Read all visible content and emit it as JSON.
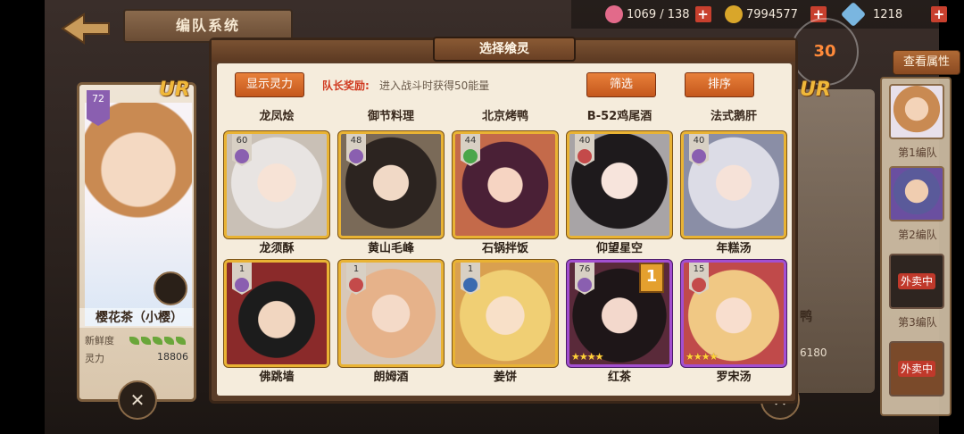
{
  "topbar": {
    "stamina": "1069 / 138",
    "gold": "7994577",
    "gems": "1218"
  },
  "header": {
    "title": "编队系统",
    "view_attributes": "查看属性",
    "counter": "30"
  },
  "leader": {
    "level": "72",
    "rarity": "UR",
    "name": "樱花茶（小樱）",
    "freshness_label": "新鲜度",
    "power_label": "灵力",
    "power_value": "18806"
  },
  "right_slot": {
    "rarity": "UR",
    "name_fragment": "鸭",
    "value_fragment": "6180"
  },
  "side_teams": [
    {
      "label": "第1编队"
    },
    {
      "label": "第2编队"
    },
    {
      "label": "第3编队",
      "status": "外卖中"
    },
    {
      "status": "外卖中"
    }
  ],
  "modal": {
    "title": "选择飨灵",
    "show_power_button": "显示灵力",
    "leader_bonus_label": "队长奖励:",
    "leader_bonus_text": "进入战斗时获得50能量",
    "filter_button": "筛选",
    "sort_button": "排序",
    "previous_row_names": [
      "龙凤烩",
      "御节料理",
      "北京烤鸭",
      "B-52鸡尾酒",
      "法式鹅肝"
    ],
    "cards": [
      {
        "name": "龙须酥",
        "level": "60",
        "frame": "gold"
      },
      {
        "name": "黄山毛峰",
        "level": "48",
        "frame": "gold"
      },
      {
        "name": "石锅拌饭",
        "level": "44",
        "frame": "gold"
      },
      {
        "name": "仰望星空",
        "level": "40",
        "frame": "gold"
      },
      {
        "name": "年糕汤",
        "level": "40",
        "frame": "gold"
      },
      {
        "name": "佛跳墙",
        "level": "1",
        "frame": "gold"
      },
      {
        "name": "朗姆酒",
        "level": "1",
        "frame": "gold"
      },
      {
        "name": "姜饼",
        "level": "1",
        "frame": "gold"
      },
      {
        "name": "红茶",
        "level": "76",
        "frame": "purple",
        "stars": "★★★★",
        "badge": "1"
      },
      {
        "name": "罗宋汤",
        "level": "15",
        "frame": "purple",
        "stars": "★★★★"
      }
    ]
  },
  "colors": {
    "accent_orange": "#d66a26",
    "gold_frame": "#e9b334",
    "purple_frame": "#a34fd0",
    "bonus_red": "#d03a20"
  }
}
